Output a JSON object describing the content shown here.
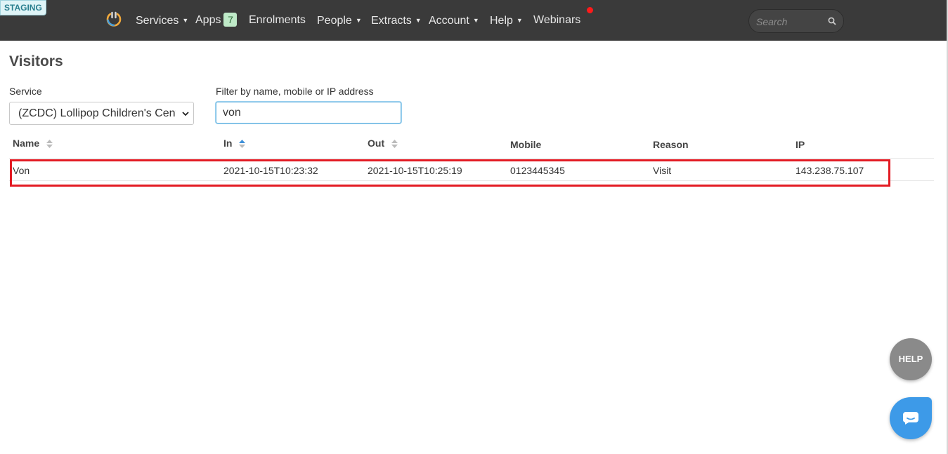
{
  "env_badge": "STAGING",
  "nav": {
    "services": "Services",
    "apps": "Apps",
    "apps_count": "7",
    "enrolments": "Enrolments",
    "people": "People",
    "extracts": "Extracts",
    "account": "Account",
    "help": "Help",
    "webinars": "Webinars",
    "search_placeholder": "Search"
  },
  "page": {
    "title": "Visitors",
    "service_label": "Service",
    "service_value": "(ZCDC) Lollipop Children's Centre",
    "filter_label": "Filter by name, mobile or IP address",
    "filter_value": "von"
  },
  "table": {
    "columns": [
      "Name",
      "In",
      "Out",
      "Mobile",
      "Reason",
      "IP"
    ],
    "rows": [
      [
        "Von",
        "2021-10-15T10:23:32",
        "2021-10-15T10:25:19",
        "0123445345",
        "Visit",
        "143.238.75.107"
      ]
    ]
  },
  "help_fab": "HELP",
  "colors": {
    "navbar": "#3a3a3a",
    "highlight": "#e31b23",
    "chat": "#3d9ae8",
    "sort_active": "#3d8fd8"
  },
  "icons": [
    "power-logo-icon",
    "search-icon",
    "sort-icon",
    "sort-asc-icon",
    "chevron-down-icon",
    "chat-icon"
  ]
}
